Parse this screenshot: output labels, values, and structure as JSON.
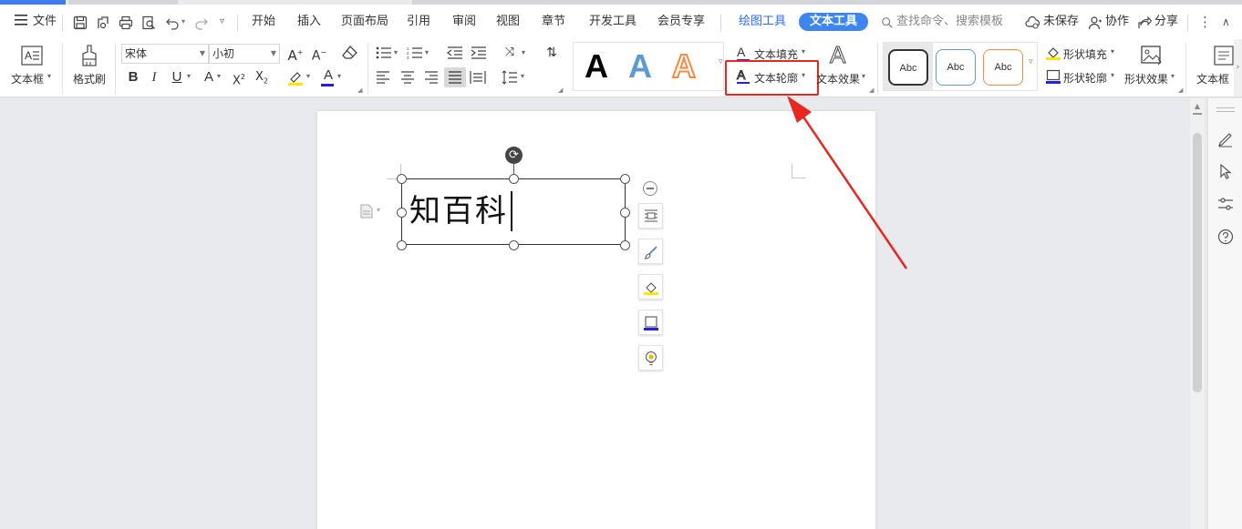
{
  "menubar": {
    "file_label": "文件",
    "tabs": [
      {
        "label": "开始"
      },
      {
        "label": "插入"
      },
      {
        "label": "页面布局"
      },
      {
        "label": "引用"
      },
      {
        "label": "审阅"
      },
      {
        "label": "视图"
      },
      {
        "label": "章节"
      },
      {
        "label": "开发工具"
      },
      {
        "label": "会员专享"
      }
    ],
    "drawing_tools_label": "绘图工具",
    "text_tools_label": "文本工具",
    "search_placeholder": "查找命令、搜索模板",
    "unsaved_label": "未保存",
    "collab_label": "协作",
    "share_label": "分享"
  },
  "ribbon": {
    "textbox_label": "文本框",
    "format_painter_label": "格式刷",
    "font_name": "宋体",
    "font_size": "小初",
    "text_fill_label": "文本填充",
    "text_outline_label": "文本轮廓",
    "text_effect_label": "文本效果",
    "abc_label": "Abc",
    "shape_fill_label": "形状填充",
    "shape_outline_label": "形状轮廓",
    "shape_effect_label": "形状效果",
    "textbox_right_label": "文本框",
    "wordart": [
      "A",
      "A",
      "A"
    ]
  },
  "document": {
    "textbox_content": "知百科"
  },
  "colors": {
    "accent": "#3d86f0",
    "highlight": "#e8271f",
    "wordart_blue": "#5b9bd5",
    "wordart_orange": "#f58a3c"
  }
}
